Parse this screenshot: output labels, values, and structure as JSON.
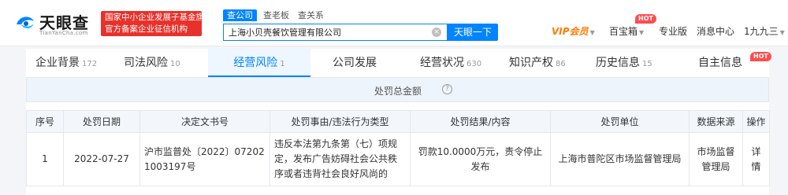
{
  "header": {
    "logo_name": "天眼查",
    "logo_url": "TianYanCha.com",
    "badge_line1": "国家中小企业发展子基金旗下",
    "badge_line2": "官方备案企业征信机构",
    "search_tabs": [
      "查公司",
      "查老板",
      "查关系"
    ],
    "search_value": "上海小贝壳餐饮管理有限公司",
    "search_button": "天眼一下",
    "nav": {
      "vip": "VIP会员",
      "treasure": "百宝箱",
      "hot": "HOT",
      "pro": "专业版",
      "messages": "消息中心",
      "user": "1九九三"
    }
  },
  "tabs": [
    {
      "label": "企业背景",
      "count": "172"
    },
    {
      "label": "司法风险",
      "count": "10"
    },
    {
      "label": "经营风险",
      "count": "1"
    },
    {
      "label": "公司发展",
      "count": ""
    },
    {
      "label": "经营状况",
      "count": "630"
    },
    {
      "label": "知识产权",
      "count": "86"
    },
    {
      "label": "历史信息",
      "count": "15"
    },
    {
      "label": "自主信息",
      "count": "",
      "badge": "HOT"
    }
  ],
  "penalty": {
    "total_label": "处罚总金额",
    "columns": [
      "序号",
      "处罚日期",
      "决定文书号",
      "处罚事由/违法行为类型",
      "处罚结果/内容",
      "处罚单位",
      "数据来源",
      "操作"
    ],
    "rows": [
      {
        "index": "1",
        "date": "2022-07-27",
        "doc_no": "沪市监普处〔2022〕072021003197号",
        "reason": "违反本法第九条第（七）项规定，发布广告妨碍社会公共秩序或者违背社会良好风尚的",
        "result": "罚款10.0000万元，责令停止发布",
        "unit": "上海市普陀区市场监督管理局",
        "source": "市场监督管理局",
        "action": "详情"
      }
    ]
  },
  "colors": {
    "primary": "#0084ff",
    "badge_red": "#e8312b",
    "vip": "#ff7a00",
    "hot": "#ff4d4f"
  }
}
